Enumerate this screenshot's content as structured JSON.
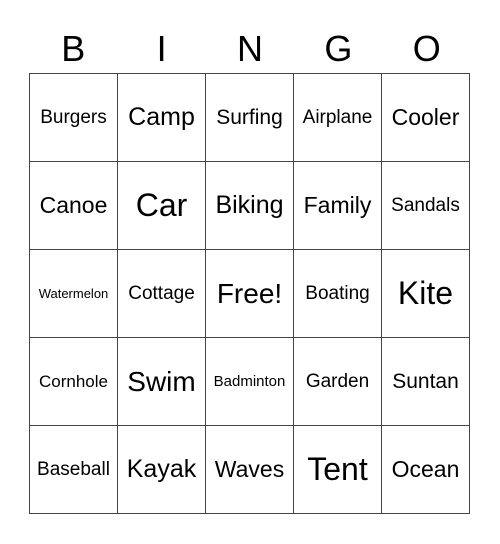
{
  "header": [
    "B",
    "I",
    "N",
    "G",
    "O"
  ],
  "grid": [
    [
      "Burgers",
      "Camp",
      "Surfing",
      "Airplane",
      "Cooler"
    ],
    [
      "Canoe",
      "Car",
      "Biking",
      "Family",
      "Sandals"
    ],
    [
      "Watermelon",
      "Cottage",
      "Free!",
      "Boating",
      "Kite"
    ],
    [
      "Cornhole",
      "Swim",
      "Badminton",
      "Garden",
      "Suntan"
    ],
    [
      "Baseball",
      "Kayak",
      "Waves",
      "Tent",
      "Ocean"
    ]
  ]
}
